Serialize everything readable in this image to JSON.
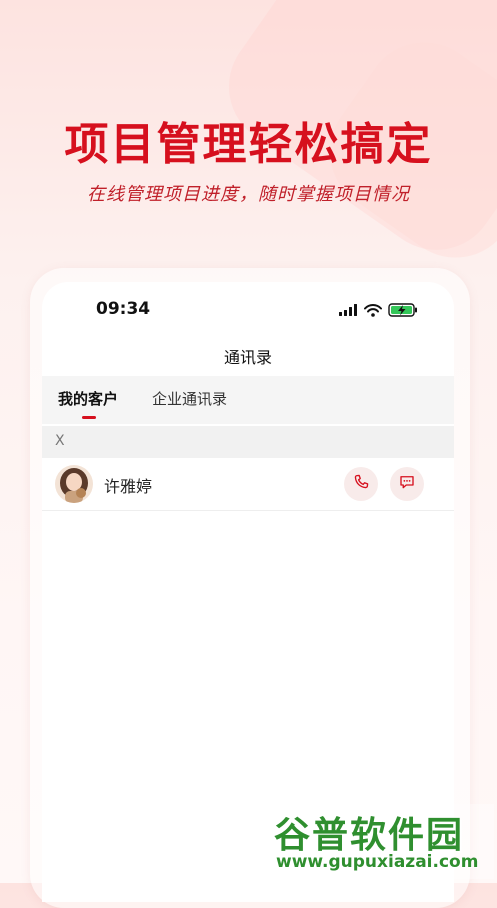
{
  "hero": {
    "title": "项目管理轻松搞定",
    "subtitle": "在线管理项目进度，随时掌握项目情况"
  },
  "status_bar": {
    "time": "09:34",
    "icons": [
      "signal-icon",
      "wifi-icon",
      "battery-charging-icon"
    ]
  },
  "nav": {
    "title": "通讯录"
  },
  "tabs": [
    {
      "label": "我的客户",
      "active": true
    },
    {
      "label": "企业通讯录",
      "active": false
    }
  ],
  "contacts": {
    "section_letter": "X",
    "items": [
      {
        "name": "许雅婷",
        "avatar": "avatar-photo",
        "actions": [
          "phone-icon",
          "message-icon"
        ]
      }
    ]
  },
  "watermark": {
    "main": "谷普软件园",
    "url": "www.gupuxiazai.com"
  },
  "colors": {
    "brand_red": "#d6101e",
    "action_bg": "#f8ebea",
    "watermark_green": "#2f8f2f"
  }
}
